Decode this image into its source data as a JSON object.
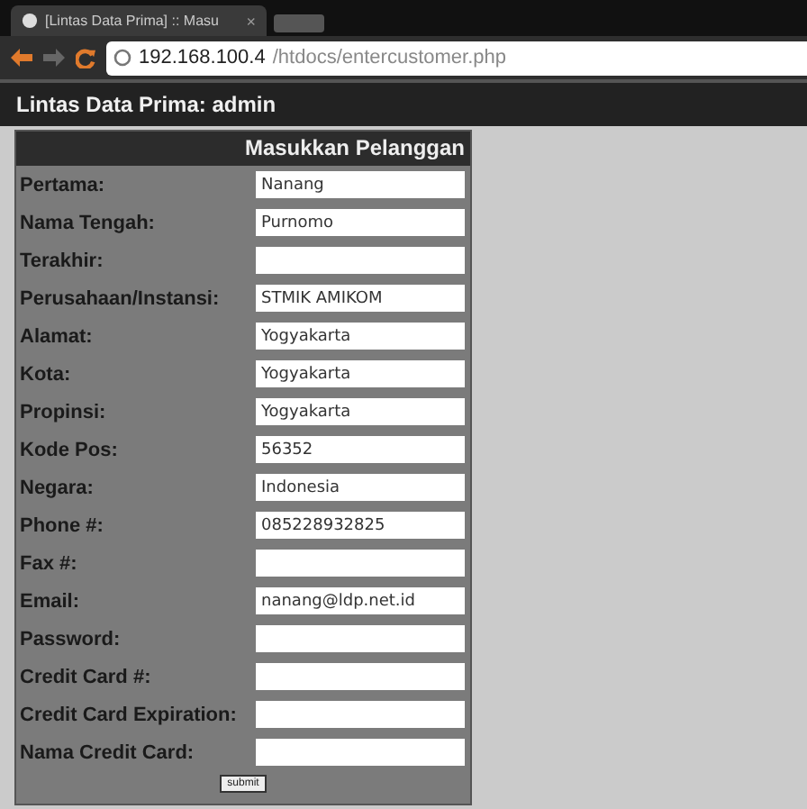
{
  "browser": {
    "tab_title": "[Lintas Data Prima] :: Masu",
    "tab_close": "×",
    "url_host": "192.168.100.4",
    "url_path": "/htdocs/entercustomer.php"
  },
  "header": {
    "title": "Lintas Data Prima: admin"
  },
  "form": {
    "title": "Masukkan Pelanggan",
    "fields": [
      {
        "label": "Pertama:",
        "value": "Nanang"
      },
      {
        "label": "Nama Tengah:",
        "value": "Purnomo"
      },
      {
        "label": "Terakhir:"
      },
      {
        "label": "Perusahaan/Instansi:",
        "value": "STMIK AMIKOM"
      },
      {
        "label": "Alamat:",
        "value": "Yogyakarta"
      },
      {
        "label": "Kota:",
        "value": "Yogyakarta"
      },
      {
        "label": "Propinsi:",
        "value": "Yogyakarta"
      },
      {
        "label": "Kode Pos:",
        "value": "56352"
      },
      {
        "label": "Negara:",
        "value": "Indonesia"
      },
      {
        "label": "Phone #:",
        "value": "085228932825"
      },
      {
        "label": "Fax #:"
      },
      {
        "label": "Email:",
        "value": "nanang@ldp.net.id"
      },
      {
        "label": "Password:"
      },
      {
        "label": "Credit Card #:"
      },
      {
        "label": "Credit Card Expiration:"
      },
      {
        "label": "Nama Credit Card:"
      }
    ],
    "submit": "submit"
  }
}
